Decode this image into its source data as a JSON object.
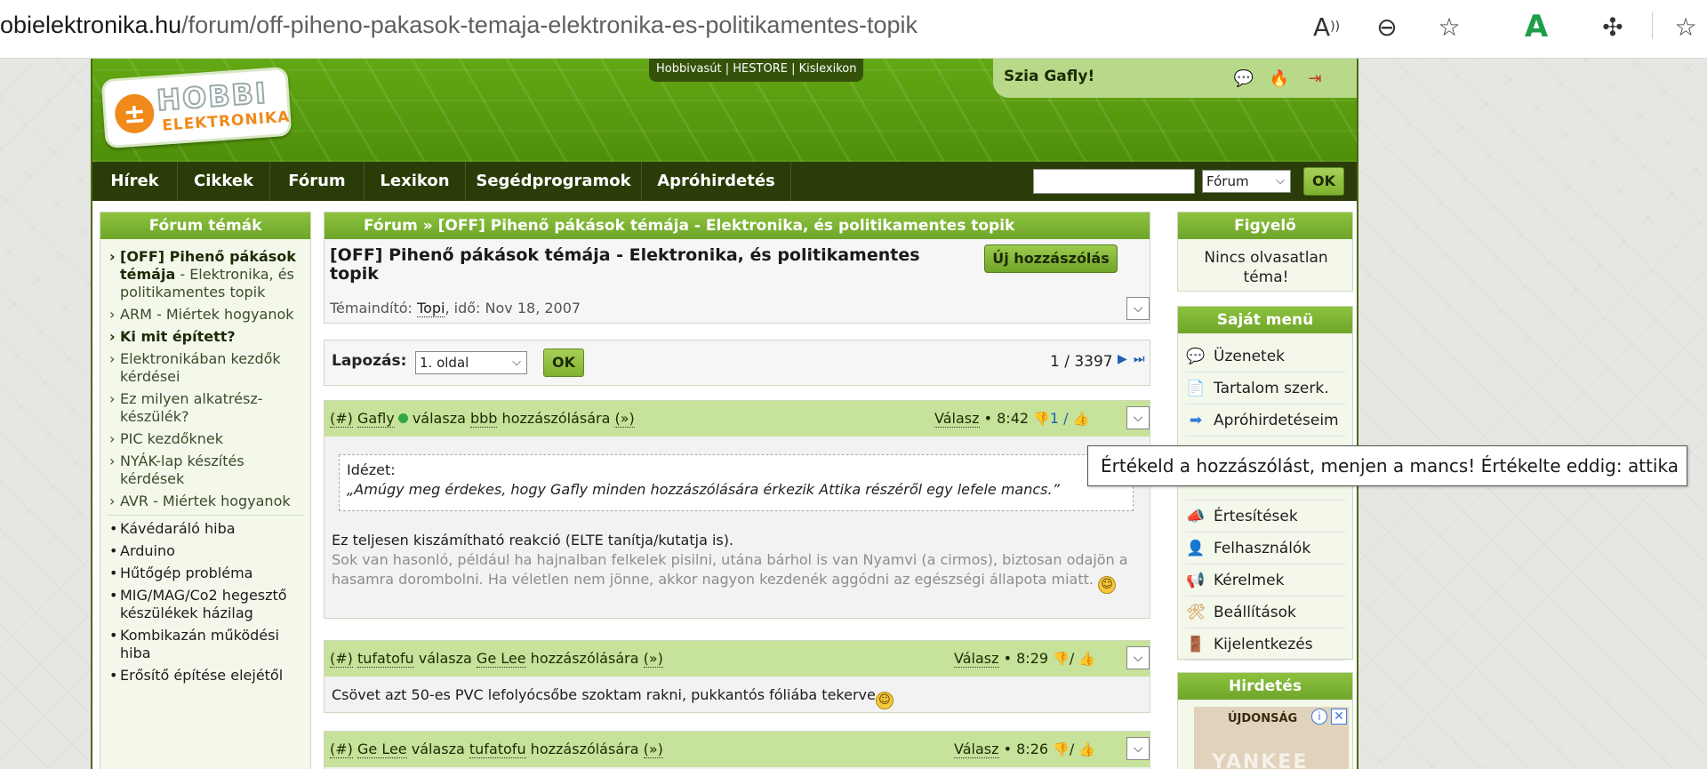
{
  "browser": {
    "url_domain": "obielektronika.hu",
    "url_path": "/forum/off-piheno-pakasok-temaja-elektronika-es-politikamentes-topik"
  },
  "site": {
    "logo_top": "HOBBI",
    "logo_bottom": "ELEKTRONIKA",
    "top_links": [
      "Hobbivasút",
      "HESTORE",
      "Kislexikon"
    ],
    "greeting": "Szia Gafly!",
    "nav": [
      "Hírek",
      "Cikkek",
      "Fórum",
      "Lexikon",
      "Segédprogramok",
      "Apróhirdetés"
    ],
    "search": {
      "value": "",
      "scope": "Fórum",
      "ok": "OK"
    }
  },
  "left": {
    "title": "Fórum témák",
    "topics": [
      {
        "text": "[OFF] Pihenő pákások témája",
        "rest": " - Elektronika, és politikamentes topik",
        "bold": true
      },
      {
        "text": "ARM - Miértek hogyanok"
      },
      {
        "text": "Ki mit épített?",
        "bold": true
      },
      {
        "text": "Elektronikában kezdők kérdései"
      },
      {
        "text": "Ez milyen alkatrész-készülék?"
      },
      {
        "text": "PIC kezdőknek"
      },
      {
        "text": "NYÁK-lap készítés kérdések"
      },
      {
        "text": "AVR - Miértek hogyanok"
      }
    ],
    "bullets": [
      "Kávédaráló hiba",
      "Arduino",
      "Hűtőgép probléma",
      "MIG/MAG/Co2 hegesztő készülékek házilag",
      "Kombikazán működési hiba",
      "Erősítő építése elejétől"
    ]
  },
  "main": {
    "breadcrumb": "Fórum » [OFF] Pihenő pákások témája - Elektronika, és politikamentes topik",
    "title": "[OFF] Pihenő pákások témája - Elektronika, és politikamentes topik",
    "new_post": "Új hozzászólás",
    "starter_label": "Témaindító:",
    "starter_user": "Topi",
    "starter_time": ", idő: Nov 18, 2007",
    "paging_label": "Lapozás:",
    "paging_select": "1. oldal",
    "paging_ok": "OK",
    "paging_count": "1 / 3397",
    "posts": [
      {
        "hash": "(#)",
        "author": "Gafly",
        "mid": "válasza",
        "target": "bbb",
        "tail": "hozzászólására",
        "arrow": "(»)",
        "reply": "Válasz",
        "time": "• 8:42",
        "rating": "1 /",
        "quote_label": "Idézet:",
        "quote_text": "„Amúgy meg érdekes, hogy Gafly minden hozzászólására érkezik Attika részéről egy lefele mancs.”",
        "body1": "Ez teljesen kiszámítható reakció (ELTE tanítja/kutatja is).",
        "body2": "Sok van hasonló, például ha hajnalban felkelek pisilni, utána bárhol is van Nyamvi (a cirmos), biztosan odajön a hasamra dorombolni. Ha véletlen nem jönne, akkor nagyon kezdenék aggódni az egészségi állapota miatt."
      },
      {
        "hash": "(#)",
        "author": "tufatofu",
        "mid": "válasza",
        "target": "Ge Lee",
        "tail": "hozzászólására",
        "arrow": "(»)",
        "reply": "Válasz",
        "time": "• 8:29",
        "rating": "/",
        "body": "Csövet azt 50-es PVC lefolyócsőbe szoktam rakni, pukkantós fóliába tekerve"
      },
      {
        "hash": "(#)",
        "author": "Ge Lee",
        "mid": "válasza",
        "target": "tufatofu",
        "tail": "hozzászólására",
        "arrow": "(»)",
        "reply": "Válasz",
        "time": "• 8:26",
        "rating": "/"
      }
    ]
  },
  "right": {
    "watch_title": "Figyelő",
    "watch_text": "Nincs olvasatlan téma!",
    "menu_title": "Saját menü",
    "menu": [
      {
        "label": "Üzenetek",
        "icon": "chat-bubble-icon"
      },
      {
        "label": "Tartalom szerk.",
        "icon": "document-icon"
      },
      {
        "label": "Apróhirdetéseim",
        "icon": "arrow-icon"
      },
      {
        "label": "Értesítések",
        "icon": "megaphone-icon"
      },
      {
        "label": "Felhasználók",
        "icon": "user-icon"
      },
      {
        "label": "Kérelmek",
        "icon": "speaker-icon"
      },
      {
        "label": "Beállítások",
        "icon": "tools-icon"
      },
      {
        "label": "Kijelentkezés",
        "icon": "exit-door-icon"
      }
    ],
    "ad_title": "Hirdetés",
    "ad_badge": "ÚJDONSÁG",
    "ad_brand": "YANKEE"
  },
  "tooltip": "Értékeld a hozzászólást, menjen a mancs! Értékelte eddig: attika",
  "colors": {
    "green": "#6fa52a",
    "dark_nav": "#2a3d08",
    "post_head": "#c7e29a"
  }
}
